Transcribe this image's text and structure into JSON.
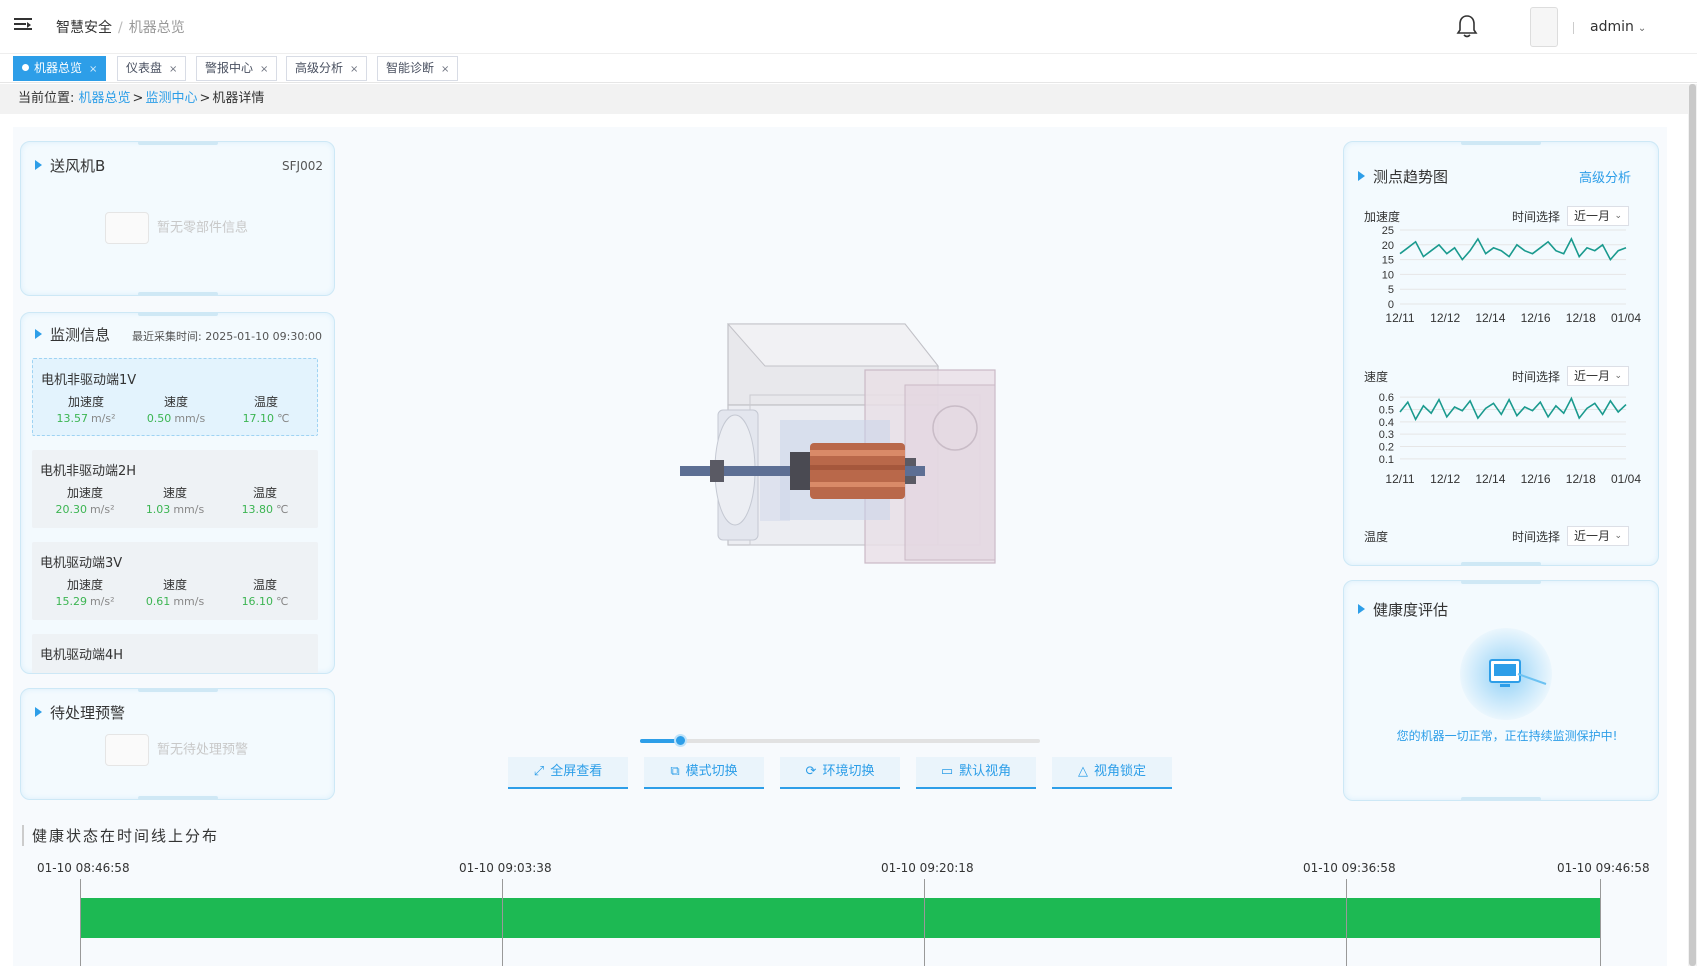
{
  "header": {
    "breadcrumb_root": "智慧安全",
    "breadcrumb_sep": "/",
    "breadcrumb_current": "机器总览",
    "user_name": "admin"
  },
  "tabs": [
    {
      "label": "机器总览",
      "active": true
    },
    {
      "label": "仪表盘",
      "active": false
    },
    {
      "label": "警报中心",
      "active": false
    },
    {
      "label": "高级分析",
      "active": false
    },
    {
      "label": "智能诊断",
      "active": false
    }
  ],
  "location": {
    "prefix": "当前位置:",
    "link1": "机器总览",
    "link2": "监测中心",
    "current": "机器详情",
    "arrow": ">"
  },
  "machine": {
    "name": "送风机B",
    "code": "SFJ002",
    "empty_parts": "暂无零部件信息"
  },
  "monitoring": {
    "title": "监测信息",
    "last_time_label": "最近采集时间:",
    "last_time": "2025-01-10 09:30:00",
    "labels": {
      "acc": "加速度",
      "vel": "速度",
      "temp": "温度"
    },
    "units": {
      "acc": "m/s²",
      "vel": "mm/s",
      "temp": "℃"
    },
    "points": [
      {
        "name": "电机非驱动端1V",
        "acc": "13.57",
        "vel": "0.50",
        "temp": "17.10"
      },
      {
        "name": "电机非驱动端2H",
        "acc": "20.30",
        "vel": "1.03",
        "temp": "13.80"
      },
      {
        "name": "电机驱动端3V",
        "acc": "15.29",
        "vel": "0.61",
        "temp": "16.10"
      },
      {
        "name": "电机驱动端4H"
      }
    ]
  },
  "alerts": {
    "title": "待处理预警",
    "empty": "暂无待处理预警"
  },
  "viewer": {
    "slider_value": 0.1,
    "buttons": [
      {
        "label": "全屏查看",
        "icon": "fullscreen-icon"
      },
      {
        "label": "模式切换",
        "icon": "mode-switch-icon"
      },
      {
        "label": "环境切换",
        "icon": "refresh-icon"
      },
      {
        "label": "默认视角",
        "icon": "cube-icon"
      },
      {
        "label": "视角锁定",
        "icon": "lock-view-icon"
      }
    ]
  },
  "trend": {
    "title": "测点趋势图",
    "advanced_link": "高级分析",
    "time_label": "时间选择",
    "range_value": "近一月",
    "line_color": "#1a9a8e"
  },
  "chart_data": [
    {
      "type": "line",
      "title": "加速度",
      "x_ticks": [
        "12/11",
        "12/12",
        "12/14",
        "12/16",
        "12/18",
        "01/04"
      ],
      "y_ticks": [
        "0",
        "5",
        "10",
        "15",
        "20",
        "25"
      ],
      "ylim": [
        0,
        25
      ],
      "series": [
        {
          "values": [
            17,
            19,
            21,
            16,
            18,
            20,
            17,
            19,
            15,
            18,
            22,
            17,
            19,
            18,
            16,
            20,
            18,
            17,
            19,
            21,
            18,
            17,
            22,
            16,
            19,
            18,
            20,
            15,
            18,
            19
          ]
        }
      ]
    },
    {
      "type": "line",
      "title": "速度",
      "x_ticks": [
        "12/11",
        "12/12",
        "12/14",
        "12/16",
        "12/18",
        "01/04"
      ],
      "y_ticks": [
        "0.1",
        "0.2",
        "0.3",
        "0.4",
        "0.5",
        "0.6"
      ],
      "ylim": [
        0.05,
        0.65
      ],
      "series": [
        {
          "values": [
            0.48,
            0.56,
            0.42,
            0.53,
            0.47,
            0.58,
            0.44,
            0.52,
            0.49,
            0.57,
            0.43,
            0.51,
            0.55,
            0.46,
            0.58,
            0.45,
            0.52,
            0.49,
            0.56,
            0.44,
            0.53,
            0.47,
            0.59,
            0.43,
            0.51,
            0.55,
            0.46,
            0.57,
            0.48,
            0.54
          ]
        }
      ]
    },
    {
      "type": "line",
      "title": "温度"
    }
  ],
  "health": {
    "title": "健康度评估",
    "message": "您的机器一切正常，正在持续监测保护中!"
  },
  "timeline": {
    "title": "健康状态在时间线上分布",
    "times": [
      "01-10 08:46:58",
      "01-10 09:03:38",
      "01-10 09:20:18",
      "01-10 09:36:58",
      "01-10 09:46:58"
    ],
    "bar_color": "#1db953",
    "status": "正常"
  }
}
